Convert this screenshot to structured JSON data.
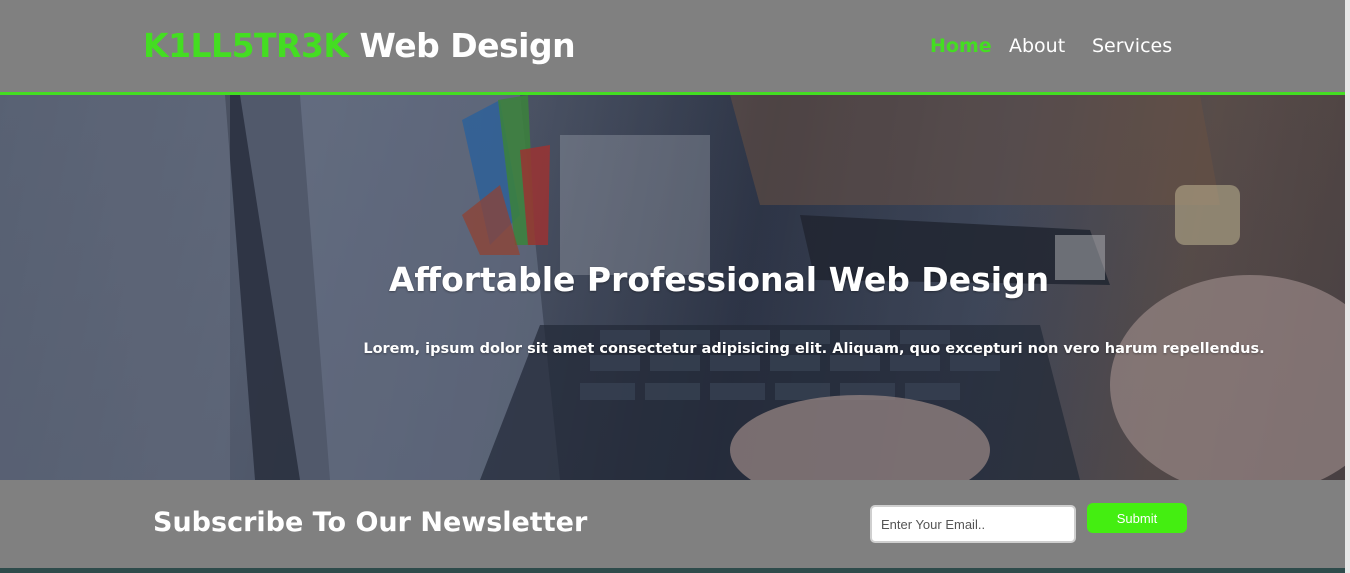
{
  "header": {
    "logo_accent": "K1LL5TR3K",
    "logo_rest": "Web Design",
    "nav": [
      {
        "label": "Home",
        "active": true
      },
      {
        "label": "About",
        "active": false
      },
      {
        "label": "Services",
        "active": false
      }
    ]
  },
  "hero": {
    "title": "Affortable Professional Web Design",
    "text": "Lorem, ipsum dolor sit amet consectetur adipisicing elit. Aliquam, quo excepturi non vero harum repellendus."
  },
  "newsletter": {
    "title": "Subscribe To Our Newsletter",
    "email_placeholder": "Enter Your Email..",
    "email_value": "",
    "submit_label": "Submit"
  },
  "colors": {
    "accent": "#44dd22",
    "header_bg": "#808080",
    "button_bg": "#44ee11"
  },
  "icons": []
}
